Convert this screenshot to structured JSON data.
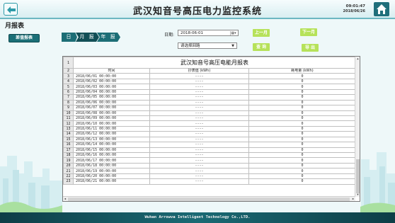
{
  "header": {
    "title": "武汉知音号高压电力监控系统",
    "time": "09:01:47",
    "date": "2018/06/26",
    "back_icon": "back-arrow-icon",
    "home_icon": "home-icon"
  },
  "page_title": "月报表",
  "diff_report_label": "差值报表",
  "tabs": [
    {
      "label": "日 报"
    },
    {
      "label": "月 报"
    },
    {
      "label": "年 报"
    }
  ],
  "filters": {
    "date_label": "日期:",
    "date_value": "2018-06-01",
    "loop_placeholder": "请选择回路"
  },
  "buttons": {
    "prev_month": "上一月",
    "next_month": "下一月",
    "query": "查 询",
    "export": "导 出"
  },
  "table": {
    "title": "武汉知音号高压电能月报表",
    "title_row_num": "1",
    "header_row_num": "2",
    "columns": [
      "时间",
      "抄表值 (kWh)",
      "耗电量 (kWh)"
    ],
    "rows": [
      {
        "n": "3",
        "time": "2018/06/01 00:00:00",
        "read": "----",
        "cons": "0"
      },
      {
        "n": "4",
        "time": "2018/06/02 00:00:00",
        "read": "----",
        "cons": "0"
      },
      {
        "n": "5",
        "time": "2018/06/03 00:00:00",
        "read": "----",
        "cons": "0"
      },
      {
        "n": "6",
        "time": "2018/06/04 00:00:00",
        "read": "----",
        "cons": "0"
      },
      {
        "n": "7",
        "time": "2018/06/05 00:00:00",
        "read": "----",
        "cons": "0"
      },
      {
        "n": "8",
        "time": "2018/06/06 00:00:00",
        "read": "----",
        "cons": "0"
      },
      {
        "n": "9",
        "time": "2018/06/07 00:00:00",
        "read": "----",
        "cons": "0"
      },
      {
        "n": "10",
        "time": "2018/06/08 00:00:00",
        "read": "----",
        "cons": "0"
      },
      {
        "n": "11",
        "time": "2018/06/09 00:00:00",
        "read": "----",
        "cons": "0"
      },
      {
        "n": "12",
        "time": "2018/06/10 00:00:00",
        "read": "----",
        "cons": "0"
      },
      {
        "n": "13",
        "time": "2018/06/11 00:00:00",
        "read": "----",
        "cons": "0"
      },
      {
        "n": "14",
        "time": "2018/06/12 00:00:00",
        "read": "----",
        "cons": "0"
      },
      {
        "n": "15",
        "time": "2018/06/13 00:00:00",
        "read": "----",
        "cons": "0"
      },
      {
        "n": "16",
        "time": "2018/06/14 00:00:00",
        "read": "----",
        "cons": "0"
      },
      {
        "n": "17",
        "time": "2018/06/15 00:00:00",
        "read": "----",
        "cons": "0"
      },
      {
        "n": "18",
        "time": "2018/06/16 00:00:00",
        "read": "----",
        "cons": "0"
      },
      {
        "n": "19",
        "time": "2018/06/17 00:00:00",
        "read": "----",
        "cons": "0"
      },
      {
        "n": "20",
        "time": "2018/06/18 00:00:00",
        "read": "----",
        "cons": "0"
      },
      {
        "n": "21",
        "time": "2018/06/19 00:00:00",
        "read": "----",
        "cons": "0"
      },
      {
        "n": "22",
        "time": "2018/06/20 00:00:00",
        "read": "----",
        "cons": "0"
      },
      {
        "n": "23",
        "time": "2018/06/21 00:00:00",
        "read": "----",
        "cons": "0"
      }
    ]
  },
  "footer": "Wuhan Arrowva Intelligent Technology Co.,LTD.",
  "colors": {
    "accent_teal": "#1b6f77",
    "button_green": "#b6e25a",
    "footer_dark": "#0e3d46"
  }
}
